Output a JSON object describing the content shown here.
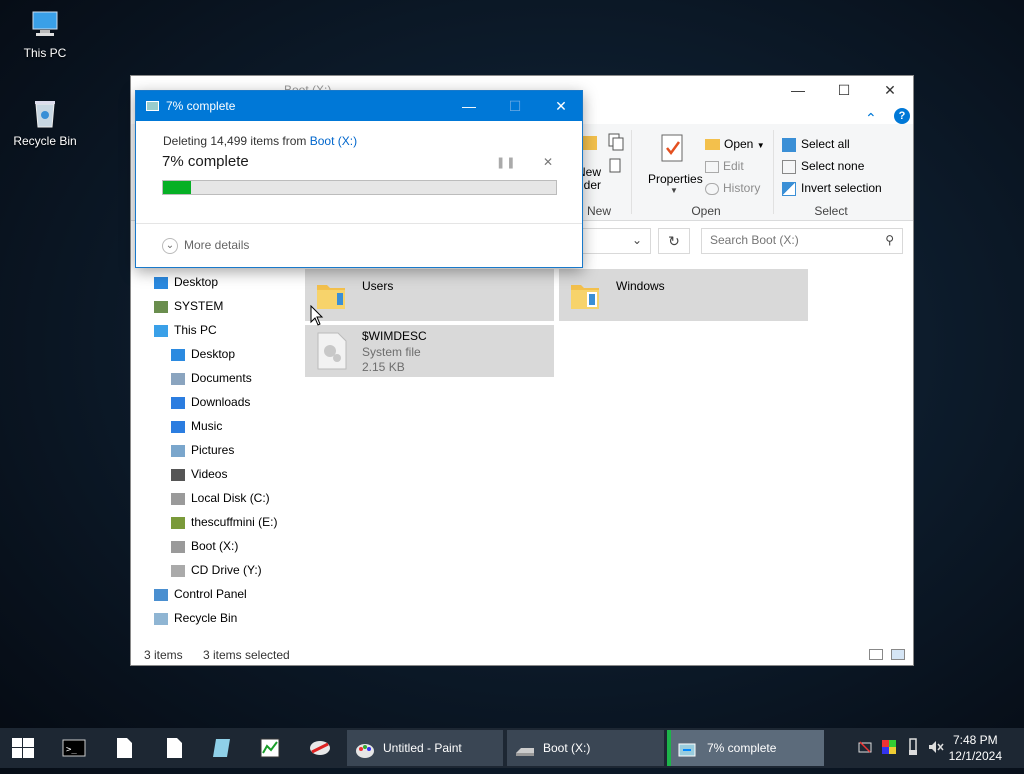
{
  "desktop": {
    "icons": [
      {
        "label": "This PC",
        "icon": "computer-icon"
      },
      {
        "label": "Recycle Bin",
        "icon": "recycle-bin-icon"
      }
    ]
  },
  "explorer": {
    "title": "Boot (X:)",
    "ribbon": {
      "new_group": {
        "label": "New",
        "partial_button": "New folder"
      },
      "open_group": {
        "label": "Open",
        "properties": "Properties",
        "open": "Open",
        "edit": "Edit",
        "history": "History"
      },
      "select_group": {
        "label": "Select",
        "select_all": "Select all",
        "select_none": "Select none",
        "invert": "Invert selection"
      }
    },
    "search": {
      "placeholder": "Search Boot (X:)"
    },
    "nav": [
      {
        "label": "Desktop",
        "icon": "desktop-icon",
        "level": 0
      },
      {
        "label": "SYSTEM",
        "icon": "user-icon",
        "level": 0
      },
      {
        "label": "This PC",
        "icon": "computer-icon",
        "level": 0
      },
      {
        "label": "Desktop",
        "icon": "desktop-icon",
        "level": 1
      },
      {
        "label": "Documents",
        "icon": "documents-icon",
        "level": 1
      },
      {
        "label": "Downloads",
        "icon": "downloads-icon",
        "level": 1
      },
      {
        "label": "Music",
        "icon": "music-icon",
        "level": 1
      },
      {
        "label": "Pictures",
        "icon": "pictures-icon",
        "level": 1
      },
      {
        "label": "Videos",
        "icon": "videos-icon",
        "level": 1
      },
      {
        "label": "Local Disk (C:)",
        "icon": "drive-icon",
        "level": 1
      },
      {
        "label": "thescuffmini (E:)",
        "icon": "usb-drive-icon",
        "level": 1
      },
      {
        "label": "Boot (X:)",
        "icon": "drive-icon",
        "level": 1,
        "selected": true
      },
      {
        "label": "CD Drive (Y:)",
        "icon": "cd-drive-icon",
        "level": 1
      },
      {
        "label": "Control Panel",
        "icon": "control-panel-icon",
        "level": 0
      },
      {
        "label": "Recycle Bin",
        "icon": "recycle-bin-icon",
        "level": 0
      }
    ],
    "items": [
      {
        "name": "Users",
        "type": "folder"
      },
      {
        "name": "Windows",
        "type": "folder"
      },
      {
        "name": "$WIMDESC",
        "type": "file",
        "subtitle": "System file",
        "size": "2.15 KB"
      }
    ],
    "status": {
      "count": "3 items",
      "selected": "3 items selected"
    }
  },
  "progress_dialog": {
    "title": "7% complete",
    "deleting_prefix": "Deleting 14,499 items from ",
    "source": "Boot (X:)",
    "heading": "7% complete",
    "progress": 0.07,
    "more_details": "More details"
  },
  "taskbar": {
    "tasks": [
      {
        "label": "Untitled - Paint",
        "icon": "paint-icon"
      },
      {
        "label": "Boot (X:)",
        "icon": "drive-icon"
      },
      {
        "label": "7% complete",
        "icon": "progress-icon",
        "active": true
      }
    ],
    "time": "7:48 PM",
    "date": "12/1/2024"
  },
  "colors": {
    "accent": "#0078d7",
    "progress_fill": "#06b025",
    "link": "#0066cc"
  }
}
